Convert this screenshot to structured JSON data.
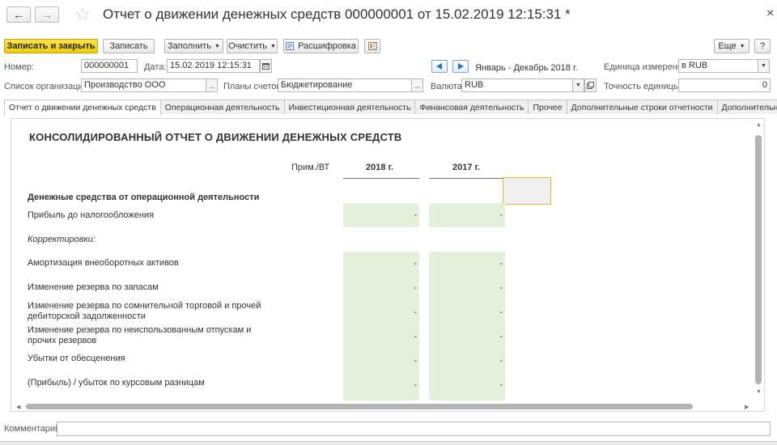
{
  "window": {
    "title": "Отчет о движении денежных средств 000000001 от 15.02.2019 12:15:31 *",
    "back_icon": "←",
    "forward_icon": "→",
    "star_icon": "☆",
    "close_icon": "×"
  },
  "toolbar": {
    "save_close": "Записать и закрыть",
    "save": "Записать",
    "fill": "Заполнить",
    "clear": "Очистить",
    "decode": "Расшифровка",
    "more": "Еще",
    "help": "?"
  },
  "form": {
    "number_label": "Номер:",
    "number_value": "000000001",
    "date_label": "Дата:",
    "date_value": "15.02.2019 12:15:31",
    "period_value": "Январь - Декабрь 2018 г.",
    "unit_label": "Единица измерения:",
    "unit_value": "в RUB",
    "orgs_label": "Список организаций:",
    "orgs_value": "Производство ООО",
    "plans_label": "Планы счетов:",
    "plans_value": "Бюджетирование",
    "currency_label": "Валюта:",
    "currency_value": "RUB",
    "precision_label": "Точность единицы:",
    "precision_value": "0",
    "ellipsis": "..."
  },
  "tabs": [
    "Отчет о движении денежных средств",
    "Операционная деятельность",
    "Инвестиционная деятельность",
    "Финансовая деятельность",
    "Прочее",
    "Дополнительные строки отчетности",
    "Дополнительно"
  ],
  "report": {
    "title": "КОНСОЛИДИРОВАННЫЙ ОТЧЕТ О ДВИЖЕНИИ ДЕНЕЖНЫХ СРЕДСТВ",
    "col_note": "Прим./ВТ",
    "col_2018": "2018 г.",
    "col_2017": "2017 г.",
    "rows": [
      {
        "label": "Денежные средства от операционной деятельности"
      },
      {
        "label": "Прибыль до налогообложения",
        "v2018": "-",
        "v2017": "-"
      },
      {
        "label": "Корректировки:"
      },
      {
        "label": "Амортизация внеоборотных активов",
        "v2018": "-",
        "v2017": "-"
      },
      {
        "label": "Изменение резерва по запасам",
        "v2018": "-",
        "v2017": "-"
      },
      {
        "label": "Изменение резерва по сомнительной торговой и прочей дебиторской задолженности",
        "v2018": "-",
        "v2017": "-"
      },
      {
        "label": "Изменение резерва по неиспользованным отпускам и прочих резервов",
        "v2018": "-",
        "v2017": "-"
      },
      {
        "label": "Убытки от обесценения",
        "v2018": "-",
        "v2017": "-"
      },
      {
        "label": "(Прибыль) / убыток по курсовым разницам",
        "v2018": "-",
        "v2017": "-"
      }
    ]
  },
  "footer": {
    "comment_label": "Комментарий:"
  }
}
